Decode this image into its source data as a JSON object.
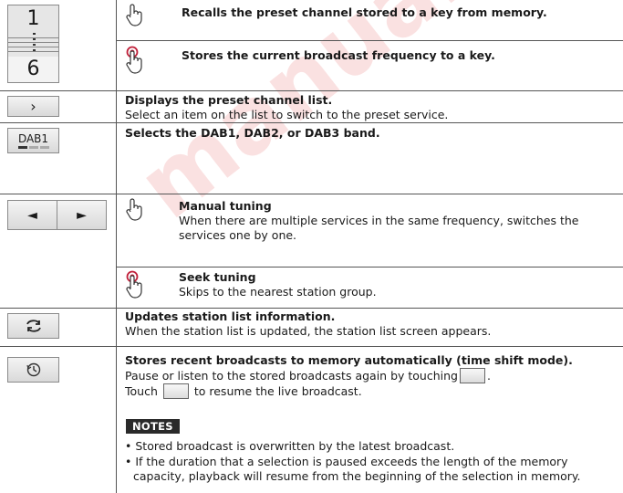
{
  "watermark": "manual.com.ua",
  "rows": {
    "preset_key": {
      "top_digit": "1",
      "bottom_digit": "6",
      "recall_text": "Recalls the preset channel stored to a key from memory.",
      "store_text": "Stores the current broadcast frequency to a key."
    },
    "preset_list": {
      "icon_glyph": "›",
      "title": "Displays the preset channel list.",
      "desc": "Select an item on the list to switch to the preset service."
    },
    "band": {
      "button_label": "DAB1",
      "title": "Selects the DAB1, DAB2, or DAB3 band."
    },
    "tuning": {
      "left_glyph": "◄",
      "right_glyph": "►",
      "manual_title": "Manual tuning",
      "manual_desc_1": "When there are multiple services in the same frequency, switches the",
      "manual_desc_2": "services one by one.",
      "seek_title": "Seek tuning",
      "seek_desc": "Skips to the nearest station group."
    },
    "update": {
      "icon_glyph": "⇄",
      "title": "Updates station list information.",
      "desc": "When the station list is updated, the station list screen appears."
    },
    "timeshift": {
      "title": "Stores recent broadcasts to memory automatically (time shift mode).",
      "desc_1": "Pause or listen to the stored broadcasts again by touching",
      "desc_1_end": ".",
      "desc_2_start": "Touch",
      "desc_2_end": "to resume the live broadcast.",
      "notes_label": "NOTES",
      "note_1": "Stored broadcast is overwritten by the latest broadcast.",
      "note_2a": "If the duration that a selection is paused exceeds the length of the memory",
      "note_2b": "capacity, playback will resume from the beginning of the selection in memory."
    }
  }
}
